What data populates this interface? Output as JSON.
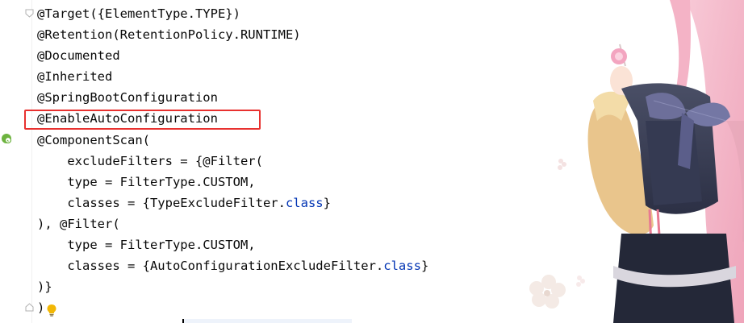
{
  "editor": {
    "lines": [
      {
        "parts": [
          {
            "t": "@Target({ElementType.TYPE})",
            "c": "ann"
          }
        ]
      },
      {
        "parts": [
          {
            "t": "@Retention(RetentionPolicy.RUNTIME)",
            "c": "ann"
          }
        ]
      },
      {
        "parts": [
          {
            "t": "@Documented",
            "c": "ann"
          }
        ]
      },
      {
        "parts": [
          {
            "t": "@Inherited",
            "c": "ann"
          }
        ]
      },
      {
        "parts": [
          {
            "t": "@SpringBootConfiguration",
            "c": "ann"
          }
        ]
      },
      {
        "parts": [
          {
            "t": "@EnableAutoConfiguration",
            "c": "ann"
          }
        ]
      },
      {
        "parts": [
          {
            "t": "@ComponentScan(",
            "c": "ann"
          }
        ]
      },
      {
        "parts": [
          {
            "t": "    excludeFilters = {@Filter(",
            "c": "ann"
          }
        ]
      },
      {
        "parts": [
          {
            "t": "    type = FilterType.CUSTOM,",
            "c": "ann"
          }
        ]
      },
      {
        "parts": [
          {
            "t": "    classes = {TypeExcludeFilter.",
            "c": "ann"
          },
          {
            "t": "class",
            "c": "kw"
          },
          {
            "t": "}",
            "c": "ann"
          }
        ]
      },
      {
        "parts": [
          {
            "t": "), @Filter(",
            "c": "ann"
          }
        ]
      },
      {
        "parts": [
          {
            "t": "    type = FilterType.CUSTOM,",
            "c": "ann"
          }
        ]
      },
      {
        "parts": [
          {
            "t": "    classes = {AutoConfigurationExcludeFilter.",
            "c": "ann"
          },
          {
            "t": "class",
            "c": "kw"
          },
          {
            "t": "}",
            "c": "ann"
          }
        ]
      },
      {
        "parts": [
          {
            "t": ")}",
            "c": "ann"
          }
        ]
      },
      {
        "parts": [
          {
            "t": ")",
            "c": "ann"
          }
        ]
      }
    ],
    "highlighted_line": "@EnableAutoConfiguration",
    "highlight_color": "#e8312f",
    "keyword_color": "#0033b3",
    "text_color": "#080808",
    "gutter_icons": [
      "fold-icon",
      "spring-bean-icon",
      "lightbulb-icon"
    ]
  }
}
